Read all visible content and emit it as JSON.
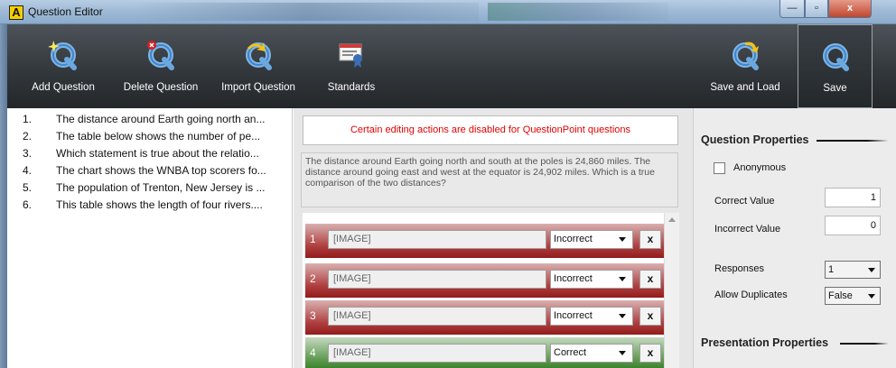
{
  "window": {
    "app_icon_letter": "A",
    "title": "Question Editor",
    "minimize_glyph": "—",
    "maximize_glyph": "▫",
    "close_glyph": "x"
  },
  "toolbar": {
    "buttons": [
      {
        "label": "Add Question",
        "icon": "add-question-icon"
      },
      {
        "label": "Delete Question",
        "icon": "delete-question-icon"
      },
      {
        "label": "Import Question",
        "icon": "import-question-icon"
      },
      {
        "label": "Standards",
        "icon": "standards-icon"
      },
      {
        "label": "Save and Load",
        "icon": "save-and-load-icon"
      },
      {
        "label": "Save",
        "icon": "save-icon"
      }
    ]
  },
  "questions": [
    {
      "num": "1.",
      "text": "The distance around Earth going north an..."
    },
    {
      "num": "2.",
      "text": "The table below shows the number of pe..."
    },
    {
      "num": "3.",
      "text": "Which statement is true about the relatio..."
    },
    {
      "num": "4.",
      "text": "The chart shows the WNBA top scorers fo..."
    },
    {
      "num": "5.",
      "text": "The population of Trenton, New Jersey is ..."
    },
    {
      "num": "6.",
      "text": "This table shows the length of four rivers...."
    }
  ],
  "editor": {
    "notice": "Certain editing actions are disabled for QuestionPoint questions",
    "question_text": "The distance around Earth going north and south at the poles is 24,860 miles. The distance around going east and west at the equator is 24,902 miles. Which is a true comparison of the two distances?",
    "responses": [
      {
        "num": "1",
        "text": "[IMAGE]",
        "value": "Incorrect",
        "delete": "x"
      },
      {
        "num": "2",
        "text": "[IMAGE]",
        "value": "Incorrect",
        "delete": "x"
      },
      {
        "num": "3",
        "text": "[IMAGE]",
        "value": "Incorrect",
        "delete": "x"
      },
      {
        "num": "4",
        "text": "[IMAGE]",
        "value": "Correct",
        "delete": "x"
      }
    ]
  },
  "properties": {
    "question_title": "Question Properties",
    "anonymous_label": "Anonymous",
    "anonymous_checked": false,
    "correct_value_label": "Correct Value",
    "correct_value": "1",
    "incorrect_value_label": "Incorrect Value",
    "incorrect_value": "0",
    "responses_label": "Responses",
    "responses_value": "1",
    "allow_duplicates_label": "Allow Duplicates",
    "allow_duplicates_value": "False",
    "presentation_title": "Presentation Properties"
  },
  "colors": {
    "incorrect_row": "#b04040",
    "correct_row": "#5e9a4f",
    "notice_text": "#e00000"
  }
}
